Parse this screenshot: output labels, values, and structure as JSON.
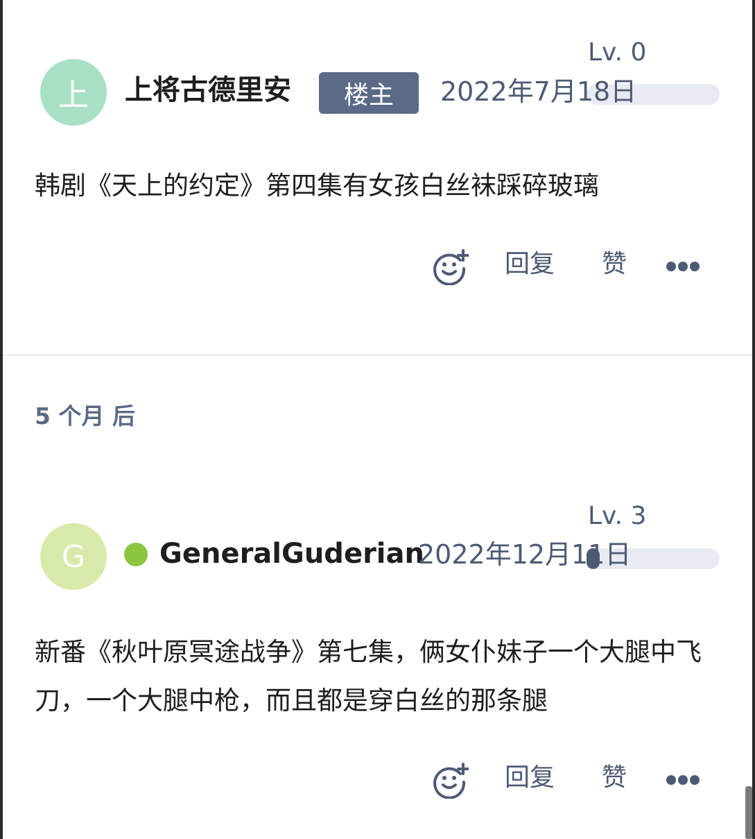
{
  "colors": {
    "meta_text": "#4c5b74",
    "badge_bg": "#5a6a87",
    "online_dot": "#8cc63f"
  },
  "posts": [
    {
      "avatar_letter": "上",
      "avatar_color": "#a8e0c4",
      "username": "上将古德里安",
      "badge": "楼主",
      "level": "Lv. 0",
      "level_progress": 0,
      "date": "2022年7月18日",
      "online": false,
      "content": "韩剧《天上的约定》第四集有女孩白丝袜踩碎玻璃",
      "actions": {
        "react_icon": "smiley-plus-icon",
        "reply": "回复",
        "like": "赞",
        "more_icon": "more-dots-icon"
      }
    },
    {
      "avatar_letter": "G",
      "avatar_color": "#d7eaa9",
      "username": "GeneralGuderian",
      "level": "Lv. 3",
      "level_progress": 0.05,
      "date": "2022年12月11日",
      "online": true,
      "content": "新番《秋叶原冥途战争》第七集，俩女仆妹子一个大腿中飞刀，一个大腿中枪，而且都是穿白丝的那条腿",
      "actions": {
        "react_icon": "smiley-plus-icon",
        "reply": "回复",
        "like": "赞",
        "more_icon": "more-dots-icon"
      }
    }
  ],
  "time_gap": "5 个月 后"
}
